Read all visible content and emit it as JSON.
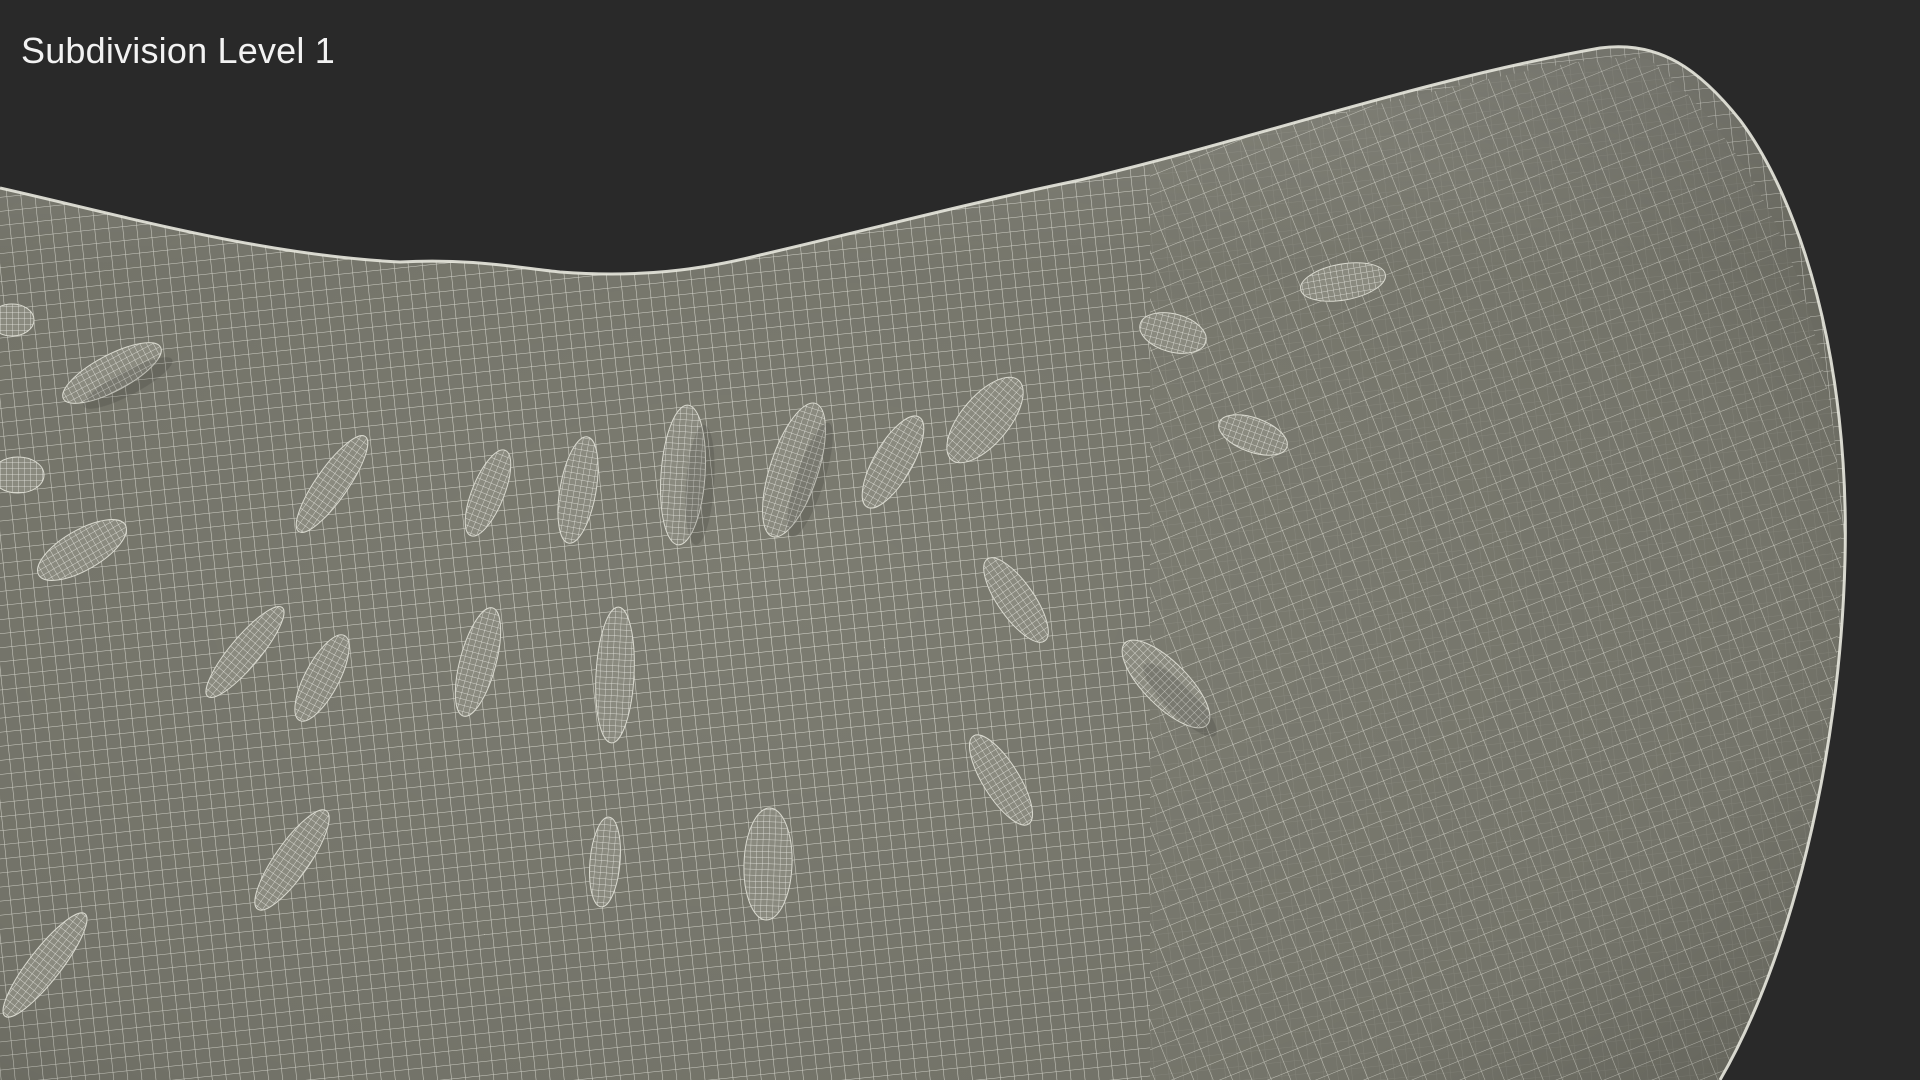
{
  "viewport": {
    "label": "Subdivision Level 1",
    "render_description_colors": {
      "background": "#292929",
      "surface": "#7b7b70",
      "wire": "#e9e9df"
    }
  }
}
